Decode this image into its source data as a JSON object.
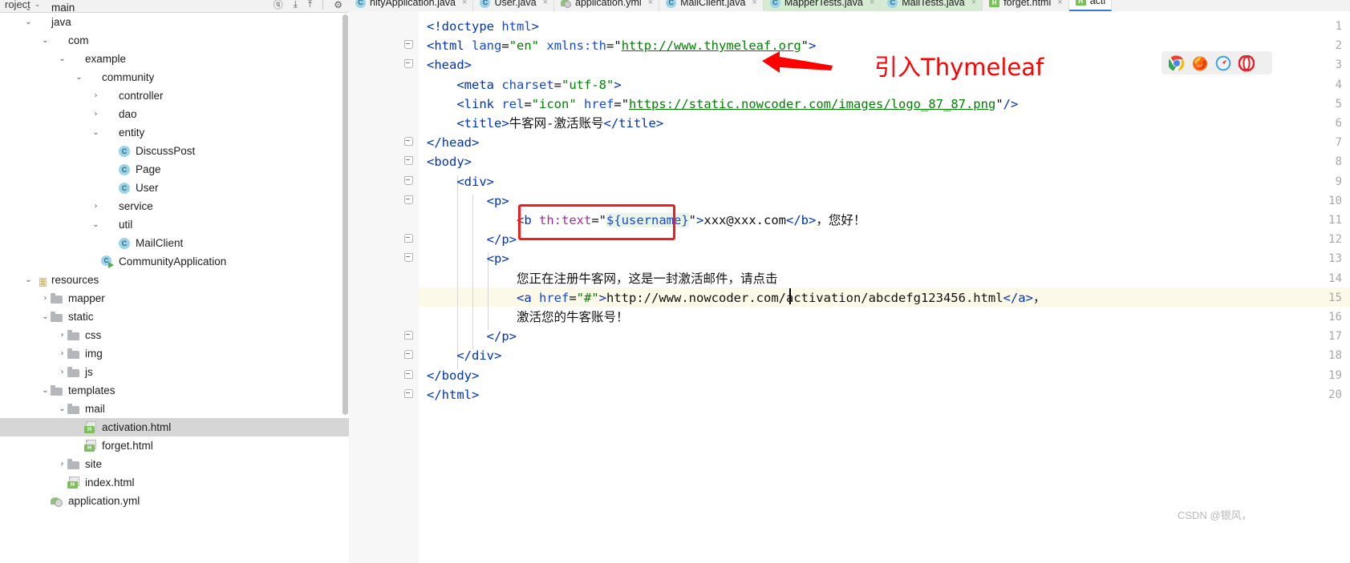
{
  "sidebar": {
    "title": "roject",
    "chevron": "⌄",
    "tools": [
      "ⓠ",
      "⤓",
      "⤒",
      "⚙"
    ],
    "tree": [
      {
        "label": "main",
        "depth": 1,
        "arrow": "⌄",
        "icon": "folder-src",
        "clipped": true
      },
      {
        "label": "java",
        "depth": 1,
        "arrow": "⌄",
        "icon": "folder-src",
        "clipped": false
      },
      {
        "label": "com",
        "depth": 2,
        "arrow": "⌄",
        "icon": "folder-pkg",
        "clipped": false
      },
      {
        "label": "example",
        "depth": 3,
        "arrow": "⌄",
        "icon": "folder-pkg",
        "clipped": false
      },
      {
        "label": "community",
        "depth": 4,
        "arrow": "⌄",
        "icon": "folder-pkg",
        "clipped": false
      },
      {
        "label": "controller",
        "depth": 5,
        "arrow": "›",
        "icon": "folder-pkg",
        "clipped": false
      },
      {
        "label": "dao",
        "depth": 5,
        "arrow": "›",
        "icon": "folder-pkg",
        "clipped": false
      },
      {
        "label": "entity",
        "depth": 5,
        "arrow": "⌄",
        "icon": "folder-pkg",
        "clipped": false
      },
      {
        "label": "DiscussPost",
        "depth": 6,
        "arrow": "",
        "icon": "cls",
        "clipped": false
      },
      {
        "label": "Page",
        "depth": 6,
        "arrow": "",
        "icon": "cls",
        "clipped": false
      },
      {
        "label": "User",
        "depth": 6,
        "arrow": "",
        "icon": "cls",
        "clipped": false
      },
      {
        "label": "service",
        "depth": 5,
        "arrow": "›",
        "icon": "folder-pkg",
        "clipped": false
      },
      {
        "label": "util",
        "depth": 5,
        "arrow": "⌄",
        "icon": "folder-pkg",
        "clipped": false
      },
      {
        "label": "MailClient",
        "depth": 6,
        "arrow": "",
        "icon": "cls",
        "clipped": false
      },
      {
        "label": "CommunityApplication",
        "depth": 5,
        "arrow": "",
        "icon": "clsrun",
        "clipped": false
      },
      {
        "label": "resources",
        "depth": 1,
        "arrow": "⌄",
        "icon": "folder-res",
        "clipped": false
      },
      {
        "label": "mapper",
        "depth": 2,
        "arrow": "›",
        "icon": "folder",
        "clipped": false
      },
      {
        "label": "static",
        "depth": 2,
        "arrow": "⌄",
        "icon": "folder",
        "clipped": false
      },
      {
        "label": "css",
        "depth": 3,
        "arrow": "›",
        "icon": "folder",
        "clipped": false
      },
      {
        "label": "img",
        "depth": 3,
        "arrow": "›",
        "icon": "folder",
        "clipped": false
      },
      {
        "label": "js",
        "depth": 3,
        "arrow": "›",
        "icon": "folder",
        "clipped": false
      },
      {
        "label": "templates",
        "depth": 2,
        "arrow": "⌄",
        "icon": "folder",
        "clipped": false
      },
      {
        "label": "mail",
        "depth": 3,
        "arrow": "⌄",
        "icon": "folder",
        "clipped": false
      },
      {
        "label": "activation.html",
        "depth": 4,
        "arrow": "",
        "icon": "htmlf",
        "clipped": false,
        "selected": true
      },
      {
        "label": "forget.html",
        "depth": 4,
        "arrow": "",
        "icon": "htmlf",
        "clipped": false
      },
      {
        "label": "site",
        "depth": 3,
        "arrow": "›",
        "icon": "folder",
        "clipped": false
      },
      {
        "label": "index.html",
        "depth": 3,
        "arrow": "",
        "icon": "htmlf",
        "clipped": false
      },
      {
        "label": "application.yml",
        "depth": 2,
        "arrow": "",
        "icon": "ymlf",
        "clipped": false
      }
    ]
  },
  "tabs": [
    {
      "label": "nityApplication.java",
      "icon": "java",
      "style": "plain",
      "close": "×"
    },
    {
      "label": "User.java",
      "icon": "java",
      "style": "plain",
      "close": "×"
    },
    {
      "label": "application.yml",
      "icon": "yml",
      "style": "plain",
      "close": "×"
    },
    {
      "label": "MailClient.java",
      "icon": "java",
      "style": "plain",
      "close": "×"
    },
    {
      "label": "MapperTests.java",
      "icon": "java",
      "style": "green",
      "close": "×"
    },
    {
      "label": "MailTests.java",
      "icon": "java",
      "style": "green",
      "close": "×"
    },
    {
      "label": "forget.html",
      "icon": "html",
      "style": "plain",
      "close": "×"
    },
    {
      "label": "acti",
      "icon": "html",
      "style": "active",
      "close": ""
    }
  ],
  "editor": {
    "file": "activation.html",
    "highlighted_line": 15,
    "line_numbers": [
      1,
      2,
      3,
      4,
      5,
      6,
      7,
      8,
      9,
      10,
      11,
      12,
      13,
      14,
      15,
      16,
      17,
      18,
      19,
      20
    ],
    "lines": [
      {
        "n": 1,
        "text": "<!doctype html>"
      },
      {
        "n": 2,
        "text": "<html lang=\"en\" xmlns:th=\"http://www.thymeleaf.org\">"
      },
      {
        "n": 3,
        "text": "<head>"
      },
      {
        "n": 4,
        "text": "    <meta charset=\"utf-8\">"
      },
      {
        "n": 5,
        "text": "    <link rel=\"icon\" href=\"https://static.nowcoder.com/images/logo_87_87.png\"/>"
      },
      {
        "n": 6,
        "text": "    <title>牛客网-激活账号</title>"
      },
      {
        "n": 7,
        "text": "</head>"
      },
      {
        "n": 8,
        "text": "<body>"
      },
      {
        "n": 9,
        "text": "    <div>"
      },
      {
        "n": 10,
        "text": "        <p>"
      },
      {
        "n": 11,
        "text": "            <b th:text=\"${username}\">xxx@xxx.com</b>，您好！"
      },
      {
        "n": 12,
        "text": "        </p>"
      },
      {
        "n": 13,
        "text": "        <p>"
      },
      {
        "n": 14,
        "text": "            您正在注册牛客网，这是一封激活邮件，请点击"
      },
      {
        "n": 15,
        "text": "            <a href=\"#\">http://www.nowcoder.com/activation/abcdefg123456.html</a>，"
      },
      {
        "n": 16,
        "text": "            激活您的牛客账号！"
      },
      {
        "n": 17,
        "text": "        </p>"
      },
      {
        "n": 18,
        "text": "    </div>"
      },
      {
        "n": 19,
        "text": "</body>"
      },
      {
        "n": 20,
        "text": "</html>"
      }
    ]
  },
  "annotations": {
    "arrow_label": "引入Thymeleaf",
    "arrow_color": "#ff0000",
    "box_color": "#ef1d1d",
    "boxed_code": "th:text=\"${username}\""
  },
  "browser_preview": {
    "icons": [
      "chrome-icon",
      "firefox-icon",
      "safari-icon",
      "opera-icon"
    ]
  },
  "watermark": "CSDN @银风，",
  "colors": {
    "tag": "#0033b3",
    "attr": "#174ad4",
    "value": "#008000",
    "thymeleaf_attr": "#9e2fa0",
    "accent_red": "#ff0000",
    "selection": "#d6d6d6",
    "caret_line": "#fdf9e8"
  }
}
